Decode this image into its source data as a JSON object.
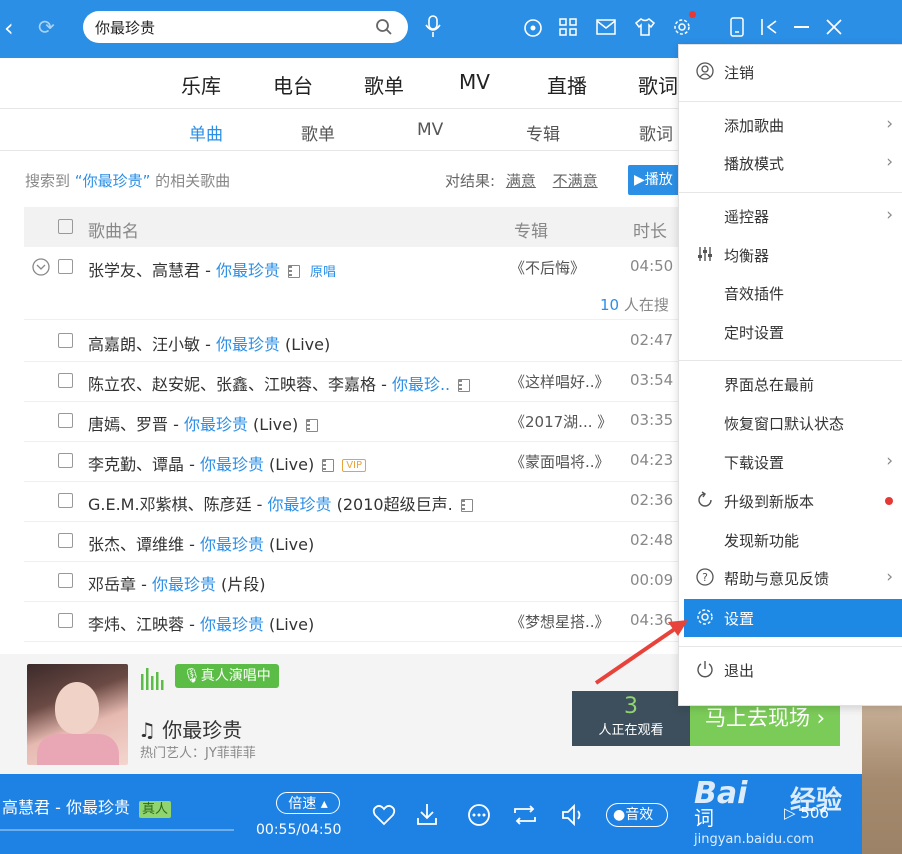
{
  "header": {
    "search_value": "你最珍贵"
  },
  "nav_main": [
    "乐库",
    "电台",
    "歌单",
    "MV",
    "直播",
    "歌词"
  ],
  "nav_sub": [
    "单曲",
    "歌单",
    "MV",
    "专辑",
    "歌词"
  ],
  "result": {
    "prefix": "搜索到",
    "keyword": "“你最珍贵”",
    "suffix": "的相关歌曲",
    "feedback_label": "对结果:",
    "satisfied": "满意",
    "unsatisfied": "不满意",
    "play_all": "播放"
  },
  "table": {
    "col_song": "歌曲名",
    "col_album": "专辑",
    "col_duration": "时长"
  },
  "rows": [
    {
      "artist": "张学友、高慧君 - ",
      "title": "你最珍贵",
      "extra": "",
      "album": "《不后悔》",
      "duration": "04:50"
    },
    {
      "artist": "高嘉朗、汪小敏 - ",
      "title": "你最珍贵",
      "extra": " (Live)",
      "album": "",
      "duration": "02:47"
    },
    {
      "artist": "陈立农、赵安妮、张鑫、江映蓉、李嘉格 - ",
      "title": "你最珍..",
      "extra": "",
      "album": "《这样唱好..》",
      "duration": "03:54"
    },
    {
      "artist": "唐嫣、罗晋 - ",
      "title": "你最珍贵",
      "extra": " (Live)",
      "album": "《2017湖... 》",
      "duration": "03:35"
    },
    {
      "artist": "李克勤、谭晶 - ",
      "title": "你最珍贵",
      "extra": " (Live)",
      "album": "《蒙面唱将..》",
      "duration": "04:23"
    },
    {
      "artist": "G.E.M.邓紫棋、陈彦廷 - ",
      "title": "你最珍贵",
      "extra": " (2010超级巨声.",
      "album": "",
      "duration": "02:36"
    },
    {
      "artist": "张杰、谭维维 - ",
      "title": "你最珍贵",
      "extra": " (Live)",
      "album": "",
      "duration": "02:48"
    },
    {
      "artist": "邓岳章 - ",
      "title": "你最珍贵",
      "extra": " (片段)",
      "album": "",
      "duration": "00:09"
    },
    {
      "artist": "李炜、江映蓉 - ",
      "title": "你最珍贵",
      "extra": " (Live)",
      "album": "《梦想星搭..》",
      "duration": "04:36"
    }
  ],
  "row0_badge": "原唱",
  "searching": {
    "count": "10",
    "label": "人在搜"
  },
  "menu": {
    "logout": "注销",
    "add_song": "添加歌曲",
    "play_mode": "播放模式",
    "remote": "遥控器",
    "equalizer": "均衡器",
    "effects": "音效插件",
    "timer": "定时设置",
    "on_top": "界面总在最前",
    "restore": "恢复窗口默认状态",
    "download": "下载设置",
    "upgrade": "升级到新版本",
    "new_features": "发现新功能",
    "help": "帮助与意见反馈",
    "settings": "设置",
    "quit": "退出"
  },
  "live": {
    "badge": "真人演唱中",
    "song": "你最珍贵",
    "artist_label": "热门艺人：JY菲菲菲",
    "viewers": "3",
    "viewers_label": "人正在观看",
    "cta": "马上去现场"
  },
  "player": {
    "now_playing": "高慧君 - 你最珍贵",
    "real_badge": "真人",
    "speed": "倍速",
    "time": "00:55/04:50",
    "effect": "音效",
    "lyric": "词",
    "count": "506"
  },
  "watermark": {
    "brand": "Bai",
    "cn": "经验",
    "url": "jingyan.baidu.com"
  },
  "colors": {
    "accent": "#2b8fe6",
    "menu_highlight": "#1e88e5",
    "live_green": "#5bbd45",
    "badge_red": "#e53935"
  }
}
